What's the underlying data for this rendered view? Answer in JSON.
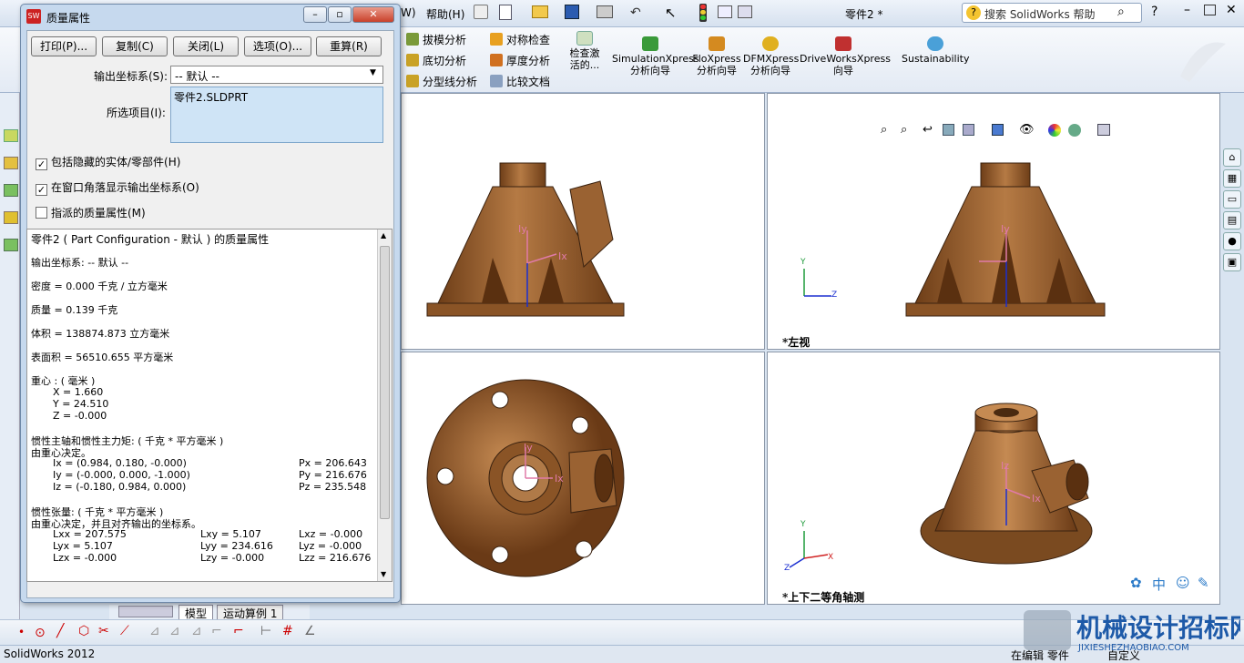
{
  "app": {
    "doc_title": "零件2 *",
    "menu_help": "帮助(H)",
    "menu_w": "W)",
    "search_placeholder": "搜索 SolidWorks 帮助",
    "status_left": "SolidWorks 2012",
    "status_editing": "在编辑 零件",
    "status_custom": "自定义"
  },
  "ribbon": {
    "small": [
      "拔模分析",
      "对称检查",
      "底切分析",
      "厚度分析",
      "分型线分析",
      "比较文档"
    ],
    "check_active": "检查激活的...",
    "big": [
      "SimulationXpress 分析向导",
      "FloXpress 分析向导",
      "DFMXpress 分析向导",
      "DriveWorksXpress 向导",
      "Sustainability"
    ]
  },
  "tabs": {
    "model": "模型",
    "motion": "运动算例 1"
  },
  "viewports": {
    "left_label": "*左视",
    "iso_label": "*上下二等角轴测",
    "axis_x": "X",
    "axis_y": "Y",
    "axis_z": "Z",
    "ix": "Ix",
    "iy": "Iy",
    "iz": "Iz"
  },
  "dialog": {
    "title": "质量属性",
    "buttons": [
      "打印(P)...",
      "复制(C)",
      "关闭(L)",
      "选项(O)...",
      "重算(R)"
    ],
    "output_coord_label": "输出坐标系(S):",
    "output_coord_value": "-- 默认 --",
    "selected_label": "所选项目(I):",
    "selected_item": "零件2.SLDPRT",
    "check1": "包括隐藏的实体/零部件(H)",
    "check2": "在窗口角落显示输出坐标系(O)",
    "check3": "指派的质量属性(M)",
    "check1_on": true,
    "check2_on": true,
    "check3_on": false,
    "results": {
      "title": "零件2 ( Part Configuration - 默认 ) 的质量属性",
      "coord": "输出坐标系: -- 默认 --",
      "density": "密度 = 0.000 千克 / 立方毫米",
      "mass": "质量 = 0.139 千克",
      "volume": "体积 = 138874.873 立方毫米",
      "area": "表面积 = 56510.655 平方毫米",
      "cog_title": "重心 : ( 毫米 )",
      "cx": "X = 1.660",
      "cy": "Y = 24.510",
      "cz": "Z = -0.000",
      "inertia_title": "惯性主轴和惯性主力矩: ( 千克 * 平方毫米 )",
      "inertia_sub": "由重心决定。",
      "ix": "Ix = (0.984, 0.180, -0.000)",
      "iy": "Iy = (-0.000, 0.000, -1.000)",
      "iz": "Iz = (-0.180, 0.984, 0.000)",
      "px": "Px = 206.643",
      "py": "Py = 216.676",
      "pz": "Pz = 235.548",
      "tensor_title": "惯性张量: ( 千克 * 平方毫米 )",
      "tensor_sub": "由重心决定，并且对齐输出的坐标系。",
      "lxx": "Lxx = 207.575",
      "lxy": "Lxy = 5.107",
      "lxz": "Lxz = -0.000",
      "lyx": "Lyx = 5.107",
      "lyy": "Lyy = 234.616",
      "lyz": "Lyz = -0.000",
      "lzx": "Lzx = -0.000",
      "lzy": "Lzy = -0.000",
      "lzz": "Lzz = 216.676"
    }
  },
  "watermark": {
    "cn": "机械设计招标网",
    "url": "JIXIESHEZHAOBIAO.COM"
  },
  "colors": {
    "part": "#9a6232",
    "axis_pink": "#e07aa8",
    "axis_blue": "#1b2fd1",
    "axis_green": "#1e9a3a",
    "axis_red": "#d02020"
  }
}
